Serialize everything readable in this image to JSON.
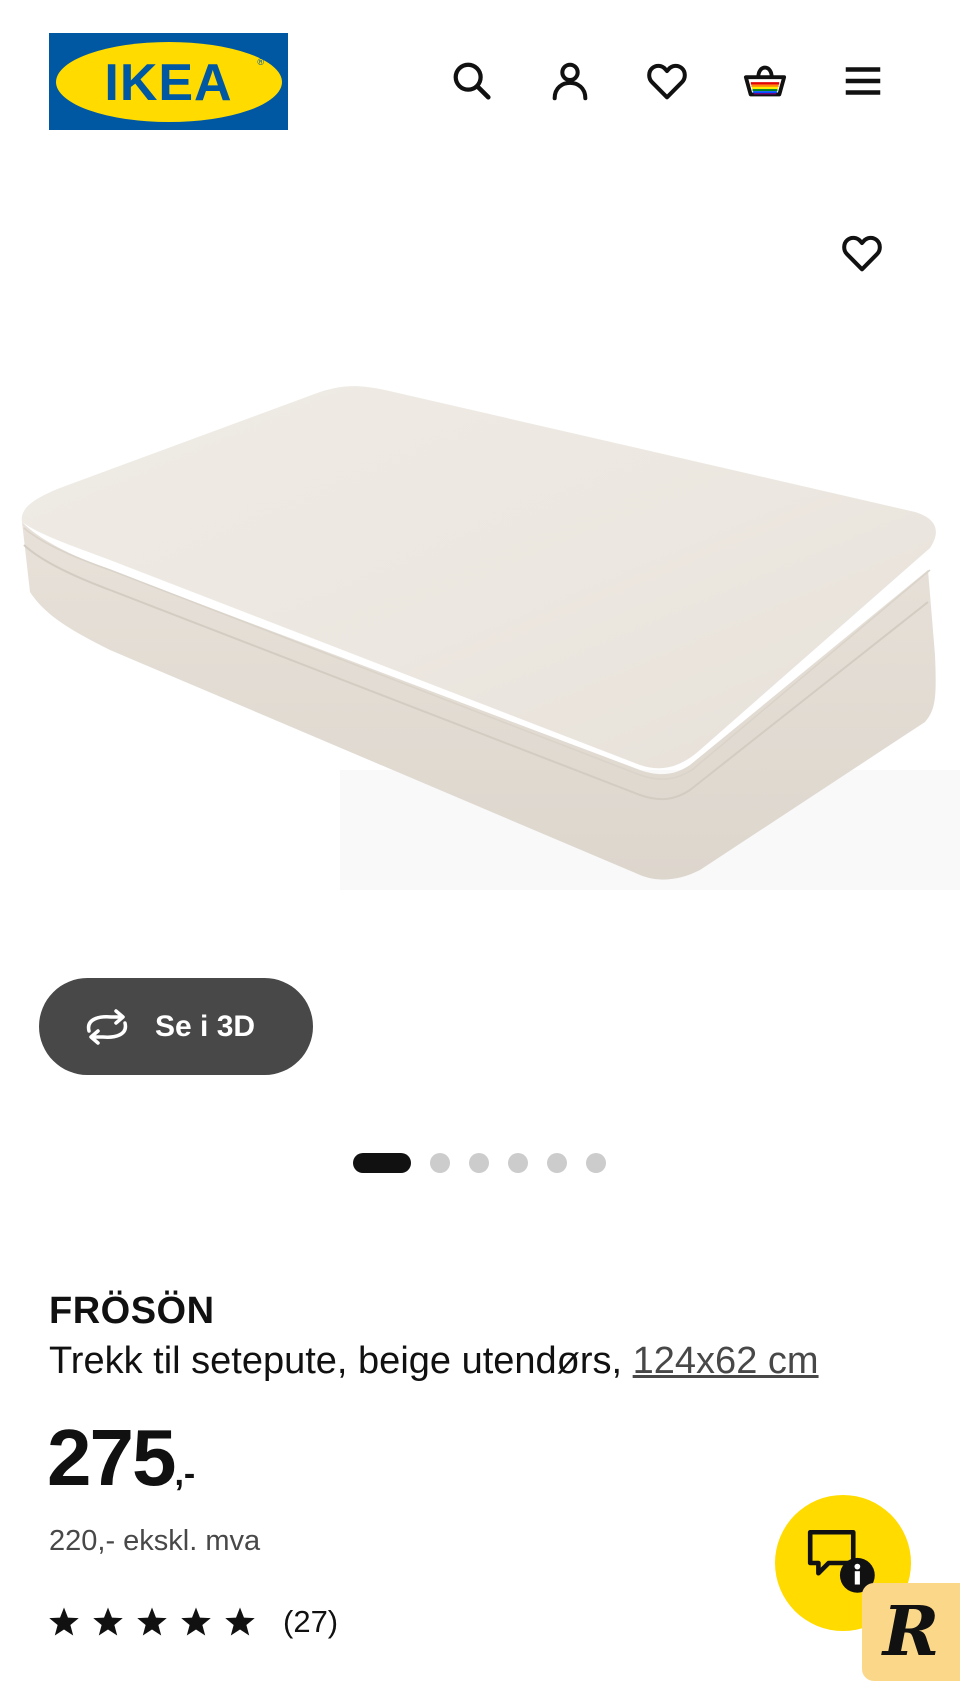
{
  "header": {
    "logo_text": "IKEA",
    "logo_reg": "®",
    "icons": [
      "search-icon",
      "profile-icon",
      "heart-icon",
      "basket-icon",
      "menu-icon"
    ]
  },
  "gallery": {
    "see_3d_label": "Se i 3D",
    "slide_count": 6,
    "active_slide": 1
  },
  "product": {
    "name": "FRÖSÖN",
    "description": "Trekk til setepute, beige utendørs, ",
    "size": "124x62 cm",
    "price_main": "275",
    "price_suffix": ",-",
    "price_ex_vat": "220,- ekskl. mva",
    "rating_stars": 5,
    "rating_count": "(27)"
  },
  "colors": {
    "brand_blue": "#0058a3",
    "brand_yellow": "#ffdb00",
    "button_dark": "#484848",
    "badge_bg": "#fbd78a"
  },
  "floating": {
    "badge_letter": "R"
  }
}
